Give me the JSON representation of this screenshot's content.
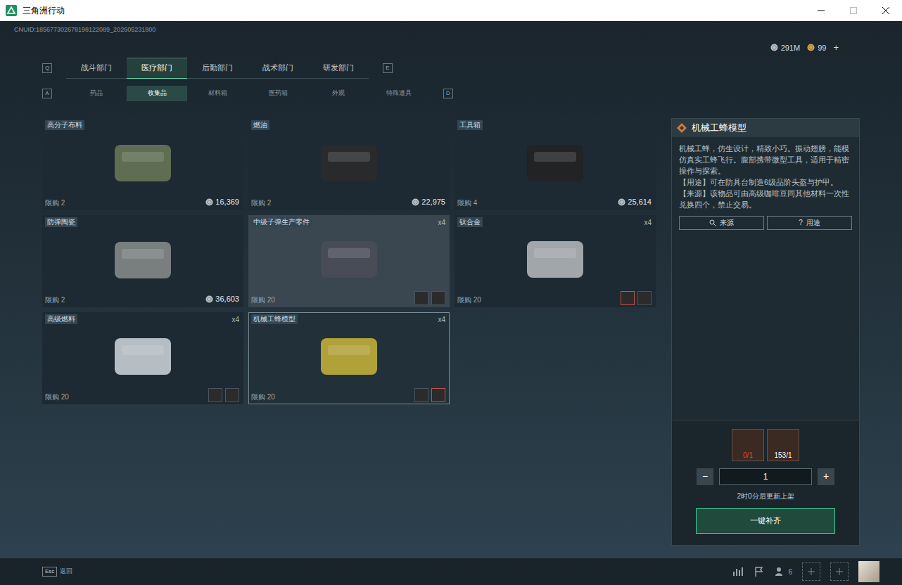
{
  "window": {
    "title": "三角洲行动"
  },
  "header": {
    "uid": "CNUID:185677302678198122089_202605231800",
    "currencies": [
      {
        "amount": "291M",
        "color": "#b8c0c6"
      },
      {
        "amount": "99",
        "color": "#d9a54a"
      }
    ],
    "add": "+"
  },
  "departments": {
    "prev_key": "Q",
    "next_key": "E",
    "tabs": [
      {
        "label": "战斗部门",
        "selected": false
      },
      {
        "label": "医疗部门",
        "selected": true
      },
      {
        "label": "后勤部门",
        "selected": false
      },
      {
        "label": "战术部门",
        "selected": false
      },
      {
        "label": "研发部门",
        "selected": false
      }
    ]
  },
  "categories": {
    "prev_key": "A",
    "next_key": "D",
    "tabs": [
      {
        "label": "药品",
        "selected": false
      },
      {
        "label": "收集品",
        "selected": true
      },
      {
        "label": "材料箱",
        "selected": false
      },
      {
        "label": "医药箱",
        "selected": false
      },
      {
        "label": "外观",
        "selected": false
      },
      {
        "label": "特殊道具",
        "selected": false
      }
    ]
  },
  "items": [
    {
      "name": "高分子布料",
      "kind": "price",
      "limit": "限购 2",
      "price": "16,369",
      "selected": false,
      "hovered": false
    },
    {
      "name": "燃油",
      "kind": "price",
      "limit": "限购 2",
      "price": "22,975",
      "selected": false,
      "hovered": false
    },
    {
      "name": "工具箱",
      "kind": "price",
      "limit": "限购 4",
      "price": "25,614",
      "selected": false,
      "hovered": false
    },
    {
      "name": "防弹陶瓷",
      "kind": "price",
      "limit": "限购 2",
      "price": "36,603",
      "selected": false,
      "hovered": false
    },
    {
      "name": "中级子弹生产零件",
      "kind": "craft",
      "count": "x4",
      "limit": "限购 20",
      "selected": false,
      "hovered": true,
      "materials": [
        {
          "active": false
        },
        {
          "active": false
        }
      ]
    },
    {
      "name": "钛合金",
      "kind": "craft",
      "count": "x4",
      "limit": "限购 20",
      "selected": false,
      "hovered": false,
      "materials": [
        {
          "active": true
        },
        {
          "active": false
        }
      ]
    },
    {
      "name": "高级燃料",
      "kind": "craft",
      "count": "x4",
      "limit": "限购 20",
      "selected": false,
      "hovered": false,
      "materials": [
        {
          "active": false
        },
        {
          "active": false
        }
      ]
    },
    {
      "name": "机械工蜂模型",
      "kind": "craft",
      "count": "x4",
      "limit": "限购 20",
      "selected": true,
      "hovered": false,
      "materials": [
        {
          "active": false
        },
        {
          "active": true
        }
      ]
    }
  ],
  "detail": {
    "title": "机械工蜂模型",
    "description": [
      "机械工蜂，仿生设计，精致小巧。振动翅膀，能模仿真实工蜂飞行。腹部携带微型工具，适用于精密操作与探索。",
      "【用途】可在防具台制造6级品阶头盔与护甲。",
      "【来源】该物品可由高级咖啡豆同其他材料一次性兑换四个，禁止交易。"
    ],
    "buttons": [
      {
        "label": "来源",
        "icon": "search"
      },
      {
        "label": "用途",
        "icon": "?"
      }
    ],
    "materials": [
      {
        "count": "0/1",
        "enough": false
      },
      {
        "count": "153/1",
        "enough": true
      }
    ],
    "quantity": {
      "minus": "−",
      "value": "1",
      "plus": "+"
    },
    "timer": "2时0分后更新上架",
    "action": "一键补齐"
  },
  "footer": {
    "key": "Esc",
    "label": "返回",
    "friends": "6"
  }
}
